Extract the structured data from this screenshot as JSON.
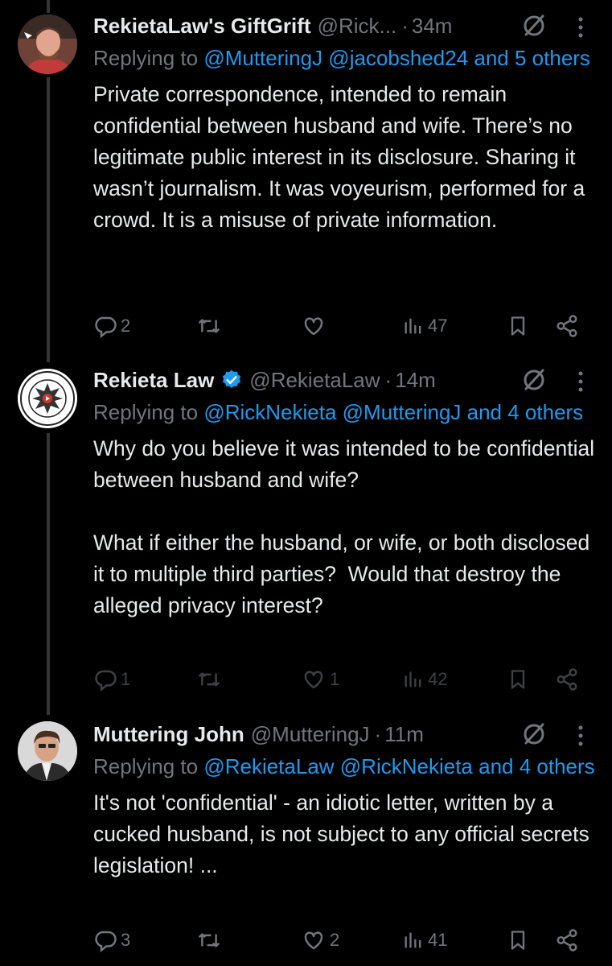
{
  "tweets": [
    {
      "name": "RekietaLaw's GiftGrift",
      "handle": "@Rick...",
      "separator": "·",
      "time": "34m",
      "replying_prefix": "Replying to",
      "replying_mentions": "@MutteringJ @jacobshed24 and 5 others",
      "body": "Private correspondence, intended to remain confidential between husband and wife. There’s no legitimate public interest in its disclosure. Sharing it wasn’t journalism. It was voyeurism, performed for a crowd. It is a misuse of private information.",
      "replies": "2",
      "retweets": "",
      "likes": "",
      "views": "47"
    },
    {
      "name": "Rekieta Law",
      "verified": true,
      "handle": "@RekietaLaw",
      "separator": "·",
      "time": "14m",
      "replying_prefix": "Replying to",
      "replying_mentions": "@RickNekieta @MutteringJ and 4 others",
      "body": "Why do you believe it was intended to be confidential between husband and wife?\n\nWhat if either the husband, or wife, or both disclosed it to multiple third parties?  Would that destroy the alleged privacy interest?",
      "replies": "1",
      "retweets": "",
      "likes": "1",
      "views": "42"
    },
    {
      "name": "Muttering John",
      "handle": "@MutteringJ",
      "separator": "·",
      "time": "11m",
      "replying_prefix": "Replying to",
      "replying_mentions": "@RekietaLaw @RickNekieta and 4 others",
      "body": "It's not 'confidential' - an idiotic letter, written by a cucked husband, is not subject to any official secrets legislation! ...",
      "replies": "3",
      "retweets": "",
      "likes": "2",
      "views": "41"
    }
  ],
  "icons": {
    "reply": "reply-icon",
    "retweet": "retweet-icon",
    "like": "heart-icon",
    "views": "views-icon",
    "bookmark": "bookmark-icon",
    "share": "share-icon",
    "grok": "grok-icon",
    "more": "more-icon",
    "verified": "verified-badge-icon"
  },
  "colors": {
    "background": "#000000",
    "text": "#e7e9ea",
    "muted": "#71767b",
    "link": "#1d9bf0",
    "verified": "#1d9bf0"
  }
}
